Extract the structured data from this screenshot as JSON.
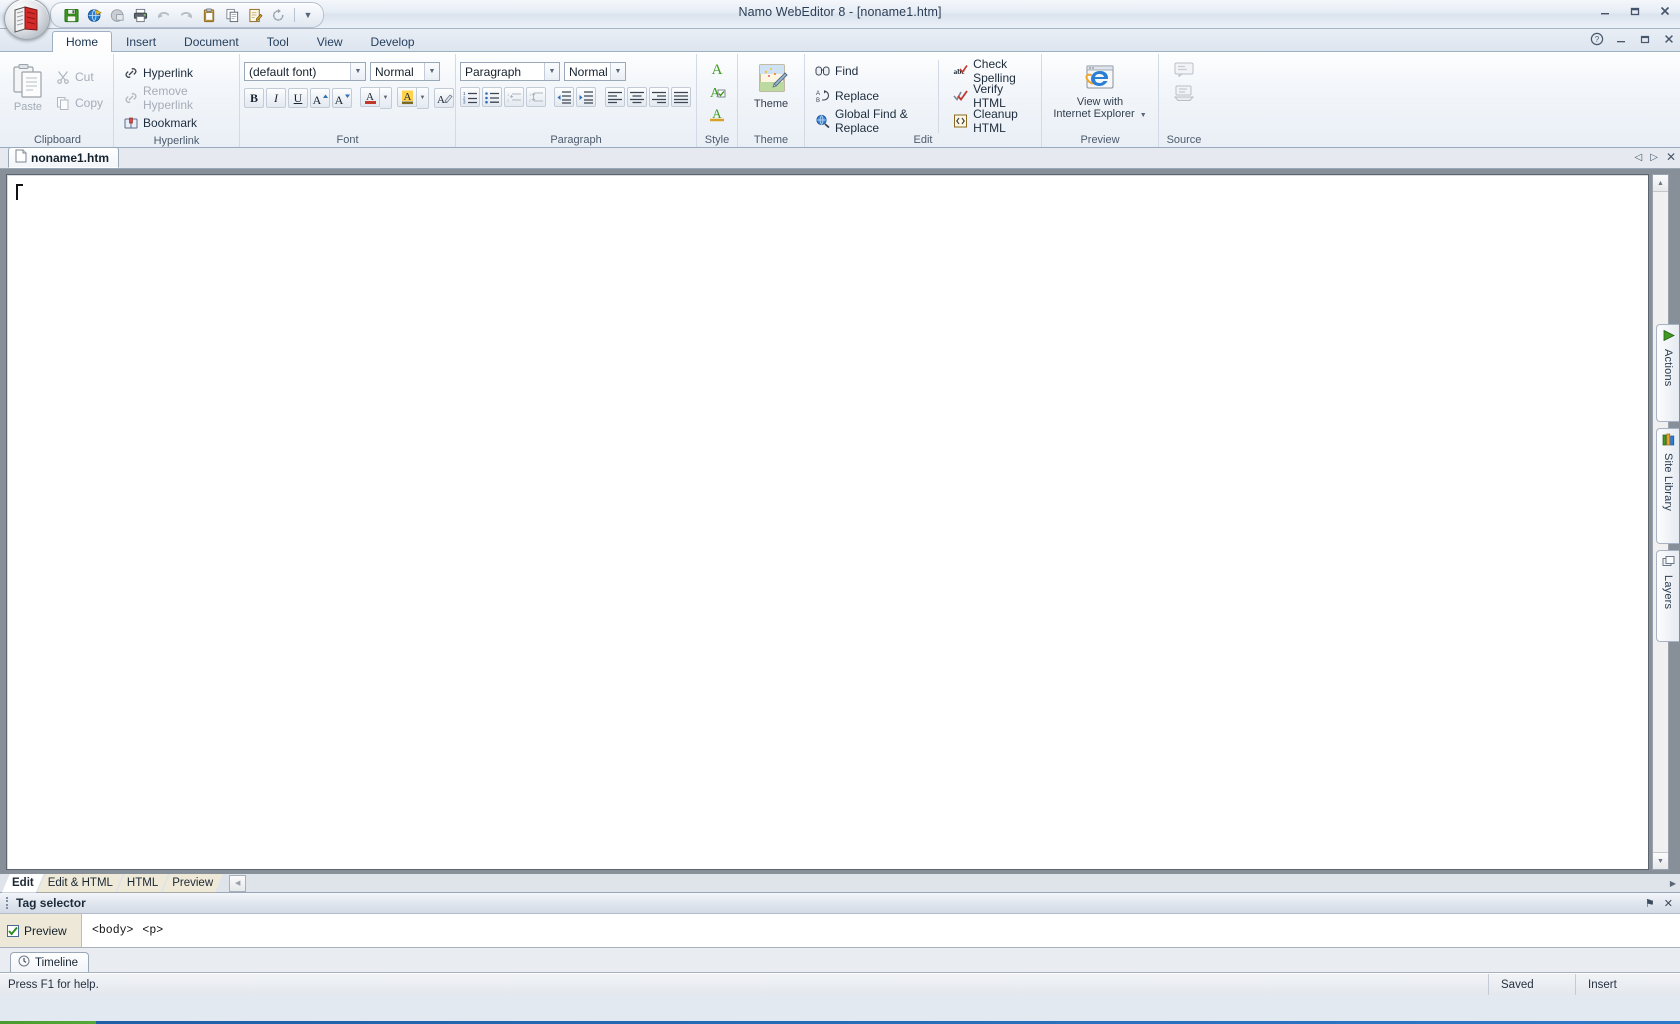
{
  "window": {
    "title": "Namo WebEditor 8 - [noname1.htm]",
    "controls": {
      "minimize": "Minimize",
      "restore": "Restore",
      "close": "Close"
    }
  },
  "quick_access": {
    "buttons": [
      {
        "name": "save-icon",
        "tip": "Save"
      },
      {
        "name": "publish-globe-icon",
        "tip": "Publish"
      },
      {
        "name": "preview-page-icon",
        "tip": "Preview",
        "disabled": true
      },
      {
        "name": "print-icon",
        "tip": "Print"
      },
      {
        "name": "undo-icon",
        "tip": "Undo",
        "disabled": true
      },
      {
        "name": "redo-icon",
        "tip": "Redo",
        "disabled": true
      },
      {
        "name": "paste-icon",
        "tip": "Paste"
      },
      {
        "name": "copy-icon",
        "tip": "Copy"
      },
      {
        "name": "edit-page-icon",
        "tip": "Edit"
      },
      {
        "name": "refresh-icon",
        "tip": "Refresh"
      }
    ],
    "more": "▼"
  },
  "ribbon": {
    "tabs": [
      {
        "label": "Home",
        "active": true
      },
      {
        "label": "Insert",
        "active": false
      },
      {
        "label": "Document",
        "active": false
      },
      {
        "label": "Tool",
        "active": false
      },
      {
        "label": "View",
        "active": false
      },
      {
        "label": "Develop",
        "active": false
      }
    ],
    "right_buttons": [
      {
        "name": "help-icon",
        "label": "?"
      },
      {
        "name": "minimize-ribbon-icon",
        "label": "–"
      },
      {
        "name": "restore-ribbon-icon",
        "label": "❐"
      },
      {
        "name": "close-ribbon-icon",
        "label": "✕"
      }
    ],
    "groups": {
      "clipboard": {
        "label": "Clipboard",
        "paste": "Paste",
        "cut": "Cut",
        "copy": "Copy"
      },
      "hyperlink": {
        "label": "Hyperlink",
        "items": [
          {
            "label": "Hyperlink",
            "disabled": false
          },
          {
            "label": "Remove Hyperlink",
            "disabled": true
          },
          {
            "label": "Bookmark",
            "disabled": false
          }
        ]
      },
      "font": {
        "label": "Font",
        "font_family": "(default font)",
        "font_size": "Normal",
        "buttons": [
          {
            "name": "bold-button",
            "glyph": "B"
          },
          {
            "name": "italic-button",
            "glyph": "I"
          },
          {
            "name": "underline-button",
            "glyph": "U"
          },
          {
            "name": "grow-font-button",
            "glyph": "A"
          },
          {
            "name": "shrink-font-button",
            "glyph": "A"
          },
          {
            "name": "font-color-button",
            "glyph": "A"
          },
          {
            "name": "highlight-color-button",
            "glyph": "A"
          },
          {
            "name": "clear-formatting-button",
            "glyph": "A"
          }
        ]
      },
      "paragraph": {
        "label": "Paragraph",
        "style": "Paragraph",
        "style_size": "Normal",
        "buttons": [
          {
            "name": "numbered-list-button"
          },
          {
            "name": "bulleted-list-button"
          },
          {
            "name": "decrease-line-spacing-button"
          },
          {
            "name": "increase-line-spacing-button"
          },
          {
            "name": "decrease-indent-button"
          },
          {
            "name": "increase-indent-button"
          },
          {
            "name": "align-left-button"
          },
          {
            "name": "align-center-button"
          },
          {
            "name": "align-right-button"
          },
          {
            "name": "align-justify-button"
          }
        ]
      },
      "style": {
        "label": "Style"
      },
      "theme": {
        "label": "Theme",
        "button": "Theme"
      },
      "edit": {
        "label": "Edit",
        "items_left": [
          {
            "label": "Find"
          },
          {
            "label": "Replace"
          },
          {
            "label": "Global Find & Replace"
          }
        ],
        "items_right": [
          {
            "label": "Check Spelling"
          },
          {
            "label": "Verify HTML"
          },
          {
            "label": "Cleanup HTML"
          }
        ]
      },
      "preview": {
        "label": "Preview",
        "button_line1": "View with",
        "button_line2": "Internet Explorer"
      },
      "source": {
        "label": "Source"
      }
    }
  },
  "document_tabs": {
    "tabs": [
      {
        "label": "noname1.htm",
        "active": true
      }
    ],
    "nav": {
      "prev": "◁",
      "next": "▷",
      "close": "✕"
    }
  },
  "side_dock": {
    "items": [
      {
        "label": "Actions",
        "icon": "play-triangle-icon"
      },
      {
        "label": "Site Library",
        "icon": "books-icon"
      },
      {
        "label": "Layers",
        "icon": "layers-icon"
      }
    ]
  },
  "view_tabs": {
    "tabs": [
      {
        "label": "Edit",
        "active": true
      },
      {
        "label": "Edit & HTML",
        "active": false
      },
      {
        "label": "HTML",
        "active": false
      },
      {
        "label": "Preview",
        "active": false
      }
    ]
  },
  "tag_selector": {
    "title": "Tag selector",
    "pin": "⚑",
    "close": "✕",
    "preview_label": "Preview",
    "preview_checked": true,
    "tags": [
      "<body>",
      "<p>"
    ]
  },
  "timeline": {
    "label": "Timeline"
  },
  "status_bar": {
    "message": "Press F1 for help.",
    "saved": "Saved",
    "mode": "Insert"
  },
  "colors": {
    "title_text": "#2c3e55",
    "ribbon_bg": "#f3f6fa",
    "editor_frame": "#878f99",
    "canvas": "#ffffff",
    "tag_preview_bg": "#ede8d8",
    "accent_green": "#3f9a23",
    "accent_yellow": "#f5c83b"
  }
}
